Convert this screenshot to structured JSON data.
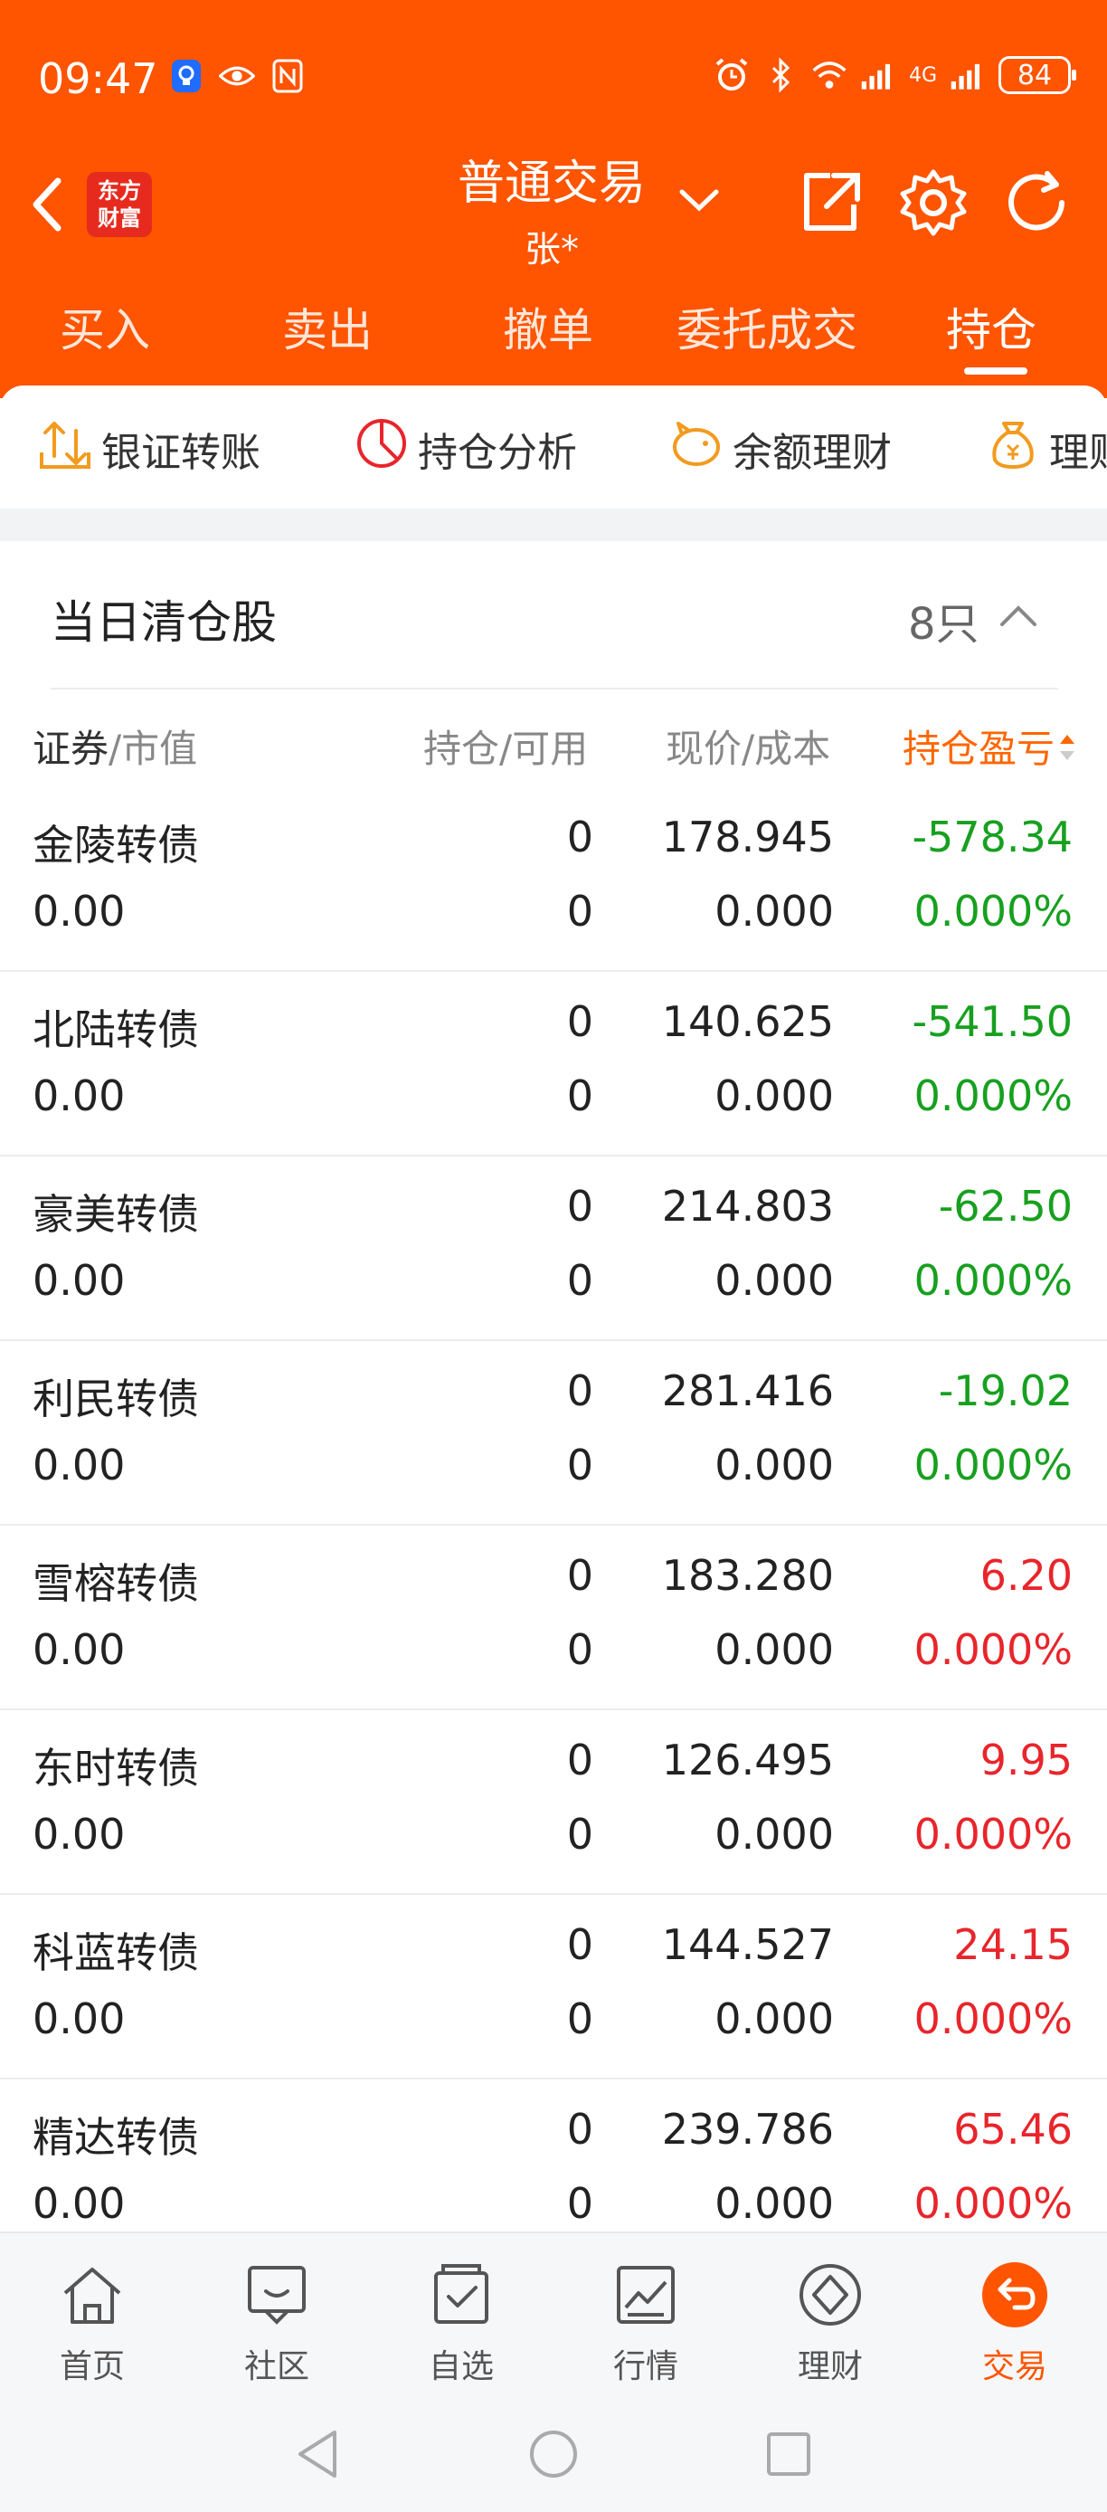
{
  "status_bar": {
    "time": "09:47",
    "network": "4G",
    "battery": "84"
  },
  "header": {
    "logo_line1": "东方",
    "logo_line2": "财富",
    "title": "普通交易",
    "subtitle": "张*"
  },
  "tabs": [
    {
      "label": "买入",
      "active": false
    },
    {
      "label": "卖出",
      "active": false
    },
    {
      "label": "撤单",
      "active": false
    },
    {
      "label": "委托成交",
      "active": false
    },
    {
      "label": "持仓",
      "active": true
    }
  ],
  "shortcuts": [
    {
      "label": "银证转账",
      "icon": "transfer-icon"
    },
    {
      "label": "持仓分析",
      "icon": "pie-chart-icon"
    },
    {
      "label": "余额理财",
      "icon": "piggy-bank-icon"
    },
    {
      "label": "理财",
      "icon": "money-bag-icon"
    }
  ],
  "section": {
    "title": "当日清仓股",
    "count": "8只"
  },
  "columns": {
    "security": "证券",
    "market_value": "/市值",
    "holding": "持仓/可用",
    "price": "现价/成本",
    "pl": "持仓盈亏"
  },
  "rows": [
    {
      "name": "金陵转债",
      "market_value": "0.00",
      "holding": "0",
      "available": "0",
      "price": "178.945",
      "cost": "0.000",
      "pl": "-578.34",
      "pl_pct": "0.000%",
      "color": "#17a01f"
    },
    {
      "name": "北陆转债",
      "market_value": "0.00",
      "holding": "0",
      "available": "0",
      "price": "140.625",
      "cost": "0.000",
      "pl": "-541.50",
      "pl_pct": "0.000%",
      "color": "#17a01f"
    },
    {
      "name": "豪美转债",
      "market_value": "0.00",
      "holding": "0",
      "available": "0",
      "price": "214.803",
      "cost": "0.000",
      "pl": "-62.50",
      "pl_pct": "0.000%",
      "color": "#17a01f"
    },
    {
      "name": "利民转债",
      "market_value": "0.00",
      "holding": "0",
      "available": "0",
      "price": "281.416",
      "cost": "0.000",
      "pl": "-19.02",
      "pl_pct": "0.000%",
      "color": "#17a01f"
    },
    {
      "name": "雪榕转债",
      "market_value": "0.00",
      "holding": "0",
      "available": "0",
      "price": "183.280",
      "cost": "0.000",
      "pl": "6.20",
      "pl_pct": "0.000%",
      "color": "#e8252b"
    },
    {
      "name": "东时转债",
      "market_value": "0.00",
      "holding": "0",
      "available": "0",
      "price": "126.495",
      "cost": "0.000",
      "pl": "9.95",
      "pl_pct": "0.000%",
      "color": "#e8252b"
    },
    {
      "name": "科蓝转债",
      "market_value": "0.00",
      "holding": "0",
      "available": "0",
      "price": "144.527",
      "cost": "0.000",
      "pl": "24.15",
      "pl_pct": "0.000%",
      "color": "#e8252b"
    },
    {
      "name": "精达转债",
      "market_value": "0.00",
      "holding": "0",
      "available": "0",
      "price": "239.786",
      "cost": "0.000",
      "pl": "65.46",
      "pl_pct": "0.000%",
      "color": "#e8252b"
    }
  ],
  "bottom_nav": [
    {
      "label": "首页",
      "icon": "home-icon",
      "active": false
    },
    {
      "label": "社区",
      "icon": "community-icon",
      "active": false
    },
    {
      "label": "自选",
      "icon": "watchlist-icon",
      "active": false
    },
    {
      "label": "行情",
      "icon": "market-chart-icon",
      "active": false
    },
    {
      "label": "理财",
      "icon": "wealth-icon",
      "active": false
    },
    {
      "label": "交易",
      "icon": "trade-icon",
      "active": true
    }
  ],
  "colors": {
    "brand": "#ff5400",
    "loss": "#17a01f",
    "gain": "#e8252b",
    "sort_header": "#ff6600"
  }
}
